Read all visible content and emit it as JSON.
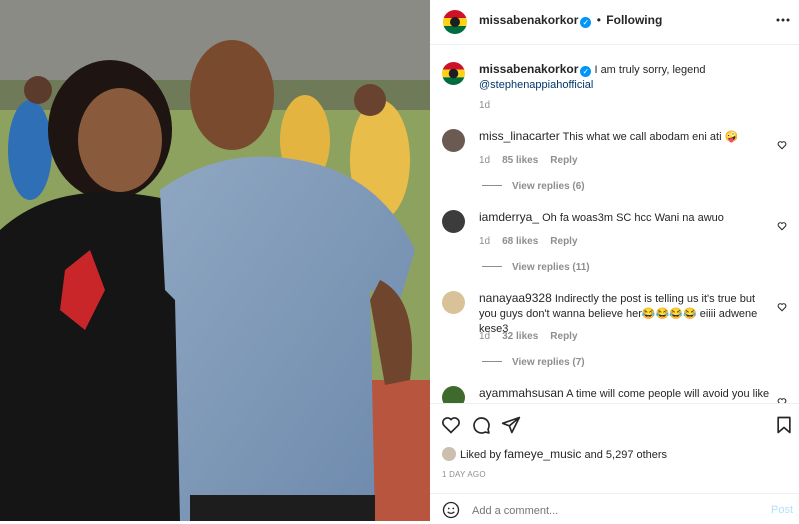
{
  "post": {
    "author": "missabenakorkor",
    "follow_separator": "•",
    "follow_label": "Following",
    "more_icon": "more-horizontal-icon"
  },
  "caption": {
    "author": "missabenakorkor",
    "text": "I am truly sorry, legend",
    "mention": "@stephenappiahofficial",
    "time": "1d"
  },
  "comments": [
    {
      "author": "miss_linacarter",
      "text": "This what we call abodam eni ati 🤪",
      "time": "1d",
      "likes": "85 likes",
      "reply": "Reply",
      "view_replies": "View replies (6)"
    },
    {
      "author": "iamderrya_",
      "text": "Oh fa woas3m SC hcc Wani na awuo",
      "time": "1d",
      "likes": "68 likes",
      "reply": "Reply",
      "view_replies": "View replies (11)"
    },
    {
      "author": "nanayaa9328",
      "text": "Indirectly the post is telling us it's true but you guys don't wanna believe her😂😂😂😂 eiiii adwene kese3",
      "time": "1d",
      "likes": "32 likes",
      "reply": "Reply",
      "view_replies": "View replies (7)"
    },
    {
      "author": "ayammahsusan",
      "text": "A time will come people will avoid you like a"
    }
  ],
  "likes": {
    "prefix": "Liked by",
    "user": "fameye_music",
    "and": "and",
    "others": "5,297 others"
  },
  "timestamp": "1 DAY AGO",
  "add_comment": {
    "placeholder": "Add a comment...",
    "post_label": "Post"
  },
  "colors": {
    "verified": "#0095f6",
    "post_disabled": "#b2dffc",
    "mention": "#00376b"
  }
}
